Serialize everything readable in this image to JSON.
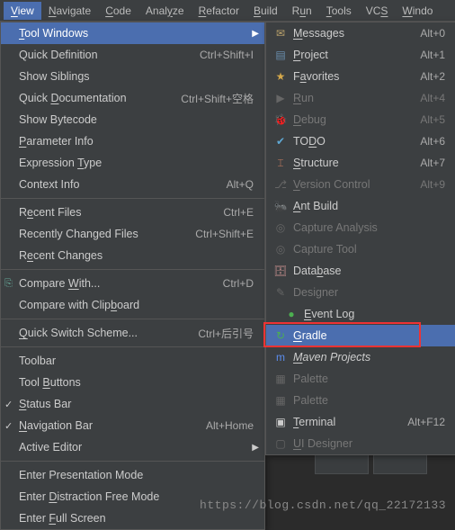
{
  "menubar": {
    "items": [
      {
        "label": "View",
        "u": 0,
        "active": true
      },
      {
        "label": "Navigate",
        "u": 0
      },
      {
        "label": "Code",
        "u": 0
      },
      {
        "label": "Analyze",
        "u": 4
      },
      {
        "label": "Refactor",
        "u": 0
      },
      {
        "label": "Build",
        "u": 0
      },
      {
        "label": "Run",
        "u": 1
      },
      {
        "label": "Tools",
        "u": 0
      },
      {
        "label": "VCS",
        "u": 2
      },
      {
        "label": "Windo",
        "u": 0
      }
    ]
  },
  "left_menu": [
    {
      "type": "item",
      "label": "Tool Windows",
      "u": 0,
      "arrow": true,
      "hl": true
    },
    {
      "type": "item",
      "label": "Quick Definition",
      "u": null,
      "shortcut": "Ctrl+Shift+I"
    },
    {
      "type": "item",
      "label": "Show Siblings",
      "u": null
    },
    {
      "type": "item",
      "label": "Quick Documentation",
      "u": 6,
      "shortcut": "Ctrl+Shift+空格"
    },
    {
      "type": "item",
      "label": "Show Bytecode",
      "u": null
    },
    {
      "type": "item",
      "label": "Parameter Info",
      "u": 0
    },
    {
      "type": "item",
      "label": "Expression Type",
      "u": 11
    },
    {
      "type": "item",
      "label": "Context Info",
      "u": null,
      "shortcut": "Alt+Q"
    },
    {
      "type": "sep"
    },
    {
      "type": "item",
      "label": "Recent Files",
      "u": 1,
      "shortcut": "Ctrl+E"
    },
    {
      "type": "item",
      "label": "Recently Changed Files",
      "u": null,
      "shortcut": "Ctrl+Shift+E"
    },
    {
      "type": "item",
      "label": "Recent Changes",
      "u": 1
    },
    {
      "type": "sep"
    },
    {
      "type": "item",
      "label": "Compare With...",
      "u": 8,
      "shortcut": "Ctrl+D",
      "icon": "compare-icon"
    },
    {
      "type": "item",
      "label": "Compare with Clipboard",
      "u": 17
    },
    {
      "type": "sep"
    },
    {
      "type": "item",
      "label": "Quick Switch Scheme...",
      "u": 0,
      "shortcut": "Ctrl+后引号"
    },
    {
      "type": "sep"
    },
    {
      "type": "item",
      "label": "Toolbar",
      "u": null
    },
    {
      "type": "item",
      "label": "Tool Buttons",
      "u": 5
    },
    {
      "type": "item",
      "label": "Status Bar",
      "u": 0,
      "check": true
    },
    {
      "type": "item",
      "label": "Navigation Bar",
      "u": 0,
      "check": true,
      "shortcut": "Alt+Home"
    },
    {
      "type": "item",
      "label": "Active Editor",
      "u": null,
      "arrow": true
    },
    {
      "type": "sep"
    },
    {
      "type": "item",
      "label": "Enter Presentation Mode",
      "u": null
    },
    {
      "type": "item",
      "label": "Enter Distraction Free Mode",
      "u": 6
    },
    {
      "type": "item",
      "label": "Enter Full Screen",
      "u": 6
    }
  ],
  "right_menu": [
    {
      "label": "Messages",
      "u": 0,
      "shortcut": "Alt+0",
      "icon": "message-icon",
      "color": "#b9a16b"
    },
    {
      "label": "Project",
      "u": 0,
      "shortcut": "Alt+1",
      "icon": "folder-icon",
      "color": "#6a8eae"
    },
    {
      "label": "Favorites",
      "u": 1,
      "shortcut": "Alt+2",
      "icon": "star-icon",
      "color": "#d4a84b"
    },
    {
      "label": "Run",
      "u": 0,
      "shortcut": "Alt+4",
      "icon": "run-icon",
      "disabled": true
    },
    {
      "label": "Debug",
      "u": 0,
      "shortcut": "Alt+5",
      "icon": "debug-icon",
      "disabled": true
    },
    {
      "label": "TODO",
      "u": 2,
      "shortcut": "Alt+6",
      "icon": "todo-icon",
      "color": "#5fa8d3"
    },
    {
      "label": "Structure",
      "u": 0,
      "shortcut": "Alt+7",
      "icon": "structure-icon",
      "color": "#c77d5f"
    },
    {
      "label": "Version Control",
      "u": 0,
      "shortcut": "Alt+9",
      "icon": "vcs-icon",
      "disabled": true
    },
    {
      "label": "Ant Build",
      "u": 0,
      "icon": "ant-icon",
      "color": "#999"
    },
    {
      "label": "Capture Analysis",
      "u": null,
      "icon": "capture-icon",
      "disabled": true
    },
    {
      "label": "Capture Tool",
      "u": null,
      "icon": "capture-icon",
      "disabled": true
    },
    {
      "label": "Database",
      "u": 4,
      "icon": "database-icon",
      "color": "#b88"
    },
    {
      "label": "Designer",
      "u": null,
      "icon": "designer-icon",
      "disabled": true
    },
    {
      "label": "Event Log",
      "u": 0,
      "icon": "balloon-icon",
      "color": "#4caf50",
      "indent": true
    },
    {
      "label": "Gradle",
      "u": 0,
      "icon": "gradle-icon",
      "hl": true,
      "redbox": true,
      "color": "#4caf50"
    },
    {
      "label": "Maven Projects",
      "u": 0,
      "icon": "maven-icon",
      "color": "#5b8def",
      "style": "italic"
    },
    {
      "label": "Palette",
      "u": null,
      "icon": "palette-icon",
      "disabled": true
    },
    {
      "label": "Palette",
      "u": null,
      "icon": "palette-icon",
      "disabled": true
    },
    {
      "label": "Terminal",
      "u": 0,
      "shortcut": "Alt+F12",
      "icon": "terminal-icon",
      "color": "#ccc"
    },
    {
      "label": "UI Designer",
      "u": 0,
      "icon": "ui-icon",
      "disabled": true
    }
  ],
  "watermark": "https://blog.csdn.net/qq_22172133"
}
